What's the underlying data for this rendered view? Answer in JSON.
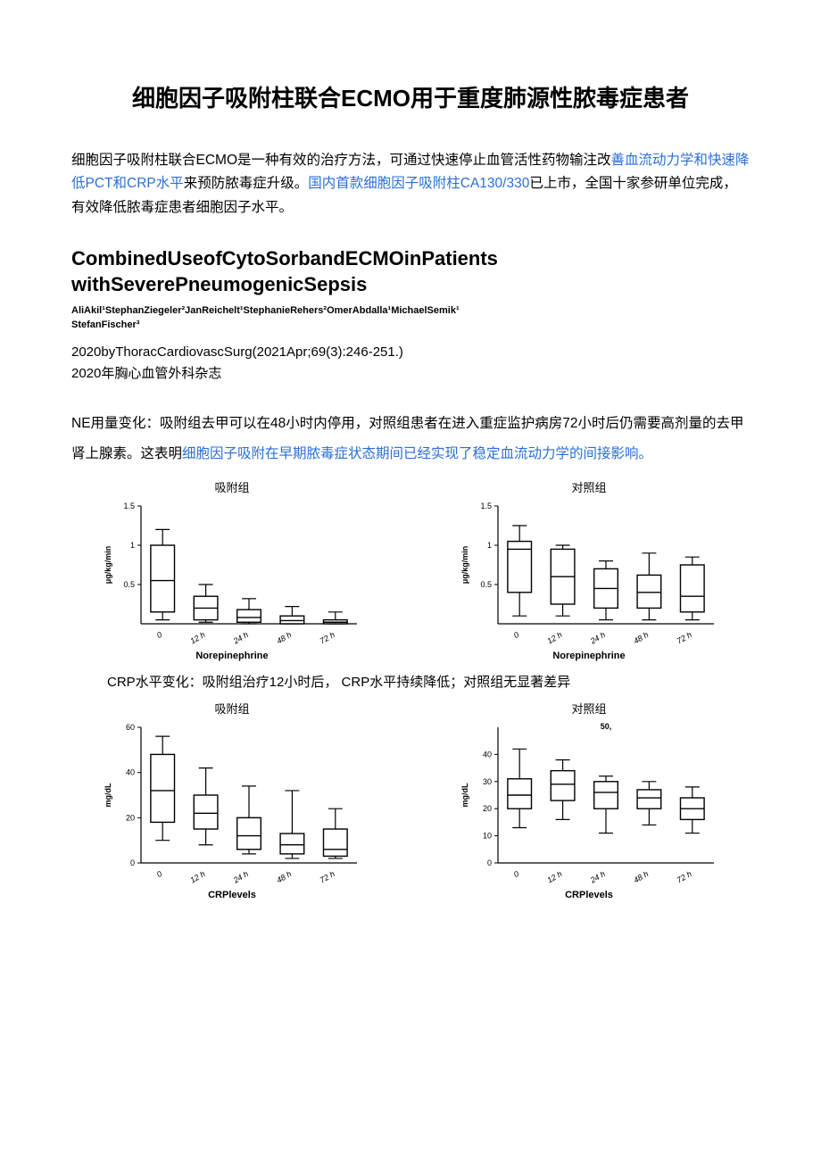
{
  "title": "细胞因子吸附柱联合ECMO用于重度肺源性脓毒症患者",
  "intro_pre": "细胞因子吸附柱联合ECMO是一种有效的治疗方法，可通过快速停止血管活性药物输注改",
  "intro_blue1": "善血流动力学和快速降低PCT和CRP水平",
  "intro_mid": "来预防脓毒症升级。",
  "intro_blue2": "国内首款细胞因子吸附柱CA130/330",
  "intro_post": "已上市，全国十家参研单位完成，有效降低脓毒症患者细胞因子水平。",
  "subtitle_l1": "CombinedUseofCytoSorbandECMOinPatients",
  "subtitle_l2": "withSeverePneumogenicSepsis",
  "authors_l1": "AliAkil¹StephanZiegeler²JanReichelt¹StephanieRehers²OmerAbdalla¹MichaelSemik¹",
  "authors_l2": "StefanFischer³",
  "citation1": "2020byThoracCardiovascSurg(2021Apr;69(3):246-251.)",
  "citation2": "2020年胸心血管外科杂志",
  "ne_text_pre": "NE用量变化：吸附组去甲可以在48小时内停用，对照组患者在进入重症监护病房72小时后仍需要高剂量的去甲肾上腺素。这表明",
  "ne_text_blue": "细胞因子吸附在早期脓毒症状态期间已经实现了稳定血流动力学的间接影响。",
  "crp_caption": "CRP水平变化：吸附组治疗12小时后， CRP水平持续降低；对照组无显著差异",
  "group_adsorb": "吸附组",
  "group_control": "对照组",
  "ne_xlabel": "Norepinephrine",
  "crp_xlabel": "CRPlevels",
  "chart_data": [
    {
      "id": "ne_adsorb",
      "type": "boxplot",
      "title": "吸附组",
      "xlabel": "Norepinephrine",
      "ylabel": "μg/kg/min",
      "categories": [
        "0",
        "12 h",
        "24 h",
        "48 h",
        "72 h"
      ],
      "ylim": [
        0,
        1.5
      ],
      "yticks": [
        0.5,
        1.0,
        1.5
      ],
      "series": [
        {
          "q1": 0.15,
          "median": 0.55,
          "q3": 1.0,
          "low": 0.05,
          "high": 1.2
        },
        {
          "q1": 0.05,
          "median": 0.2,
          "q3": 0.35,
          "low": 0.02,
          "high": 0.5
        },
        {
          "q1": 0.02,
          "median": 0.08,
          "q3": 0.18,
          "low": 0.0,
          "high": 0.32
        },
        {
          "q1": 0.0,
          "median": 0.04,
          "q3": 0.1,
          "low": 0.0,
          "high": 0.22
        },
        {
          "q1": 0.0,
          "median": 0.02,
          "q3": 0.05,
          "low": 0.0,
          "high": 0.15
        }
      ]
    },
    {
      "id": "ne_control",
      "type": "boxplot",
      "title": "对照组",
      "xlabel": "Norepinephrine",
      "ylabel": "μg/kg/min",
      "categories": [
        "0",
        "12 h",
        "24 h",
        "48 h",
        "72 h"
      ],
      "ylim": [
        0,
        1.5
      ],
      "yticks": [
        0.5,
        1.0,
        1.5
      ],
      "series": [
        {
          "q1": 0.4,
          "median": 0.95,
          "q3": 1.05,
          "low": 0.1,
          "high": 1.25
        },
        {
          "q1": 0.25,
          "median": 0.6,
          "q3": 0.95,
          "low": 0.1,
          "high": 1.0
        },
        {
          "q1": 0.2,
          "median": 0.45,
          "q3": 0.7,
          "low": 0.05,
          "high": 0.8
        },
        {
          "q1": 0.2,
          "median": 0.4,
          "q3": 0.62,
          "low": 0.05,
          "high": 0.9
        },
        {
          "q1": 0.15,
          "median": 0.35,
          "q3": 0.75,
          "low": 0.05,
          "high": 0.85
        }
      ]
    },
    {
      "id": "crp_adsorb",
      "type": "boxplot",
      "title": "吸附组",
      "xlabel": "CRPlevels",
      "ylabel": "mg/dL",
      "categories": [
        "0",
        "12 h",
        "24 h",
        "48 h",
        "72 h"
      ],
      "ylim": [
        0,
        60
      ],
      "yticks": [
        0,
        20,
        40,
        60
      ],
      "series": [
        {
          "q1": 18,
          "median": 32,
          "q3": 48,
          "low": 10,
          "high": 56
        },
        {
          "q1": 15,
          "median": 22,
          "q3": 30,
          "low": 8,
          "high": 42
        },
        {
          "q1": 6,
          "median": 12,
          "q3": 20,
          "low": 4,
          "high": 34
        },
        {
          "q1": 4,
          "median": 8,
          "q3": 13,
          "low": 2,
          "high": 32
        },
        {
          "q1": 3,
          "median": 6,
          "q3": 15,
          "low": 2,
          "high": 24
        }
      ]
    },
    {
      "id": "crp_control",
      "type": "boxplot",
      "title": "对照组",
      "xlabel": "CRPlevels",
      "ylabel": "mg/dL",
      "categories": [
        "0",
        "12 h",
        "24 h",
        "48 h",
        "72 h"
      ],
      "ylim": [
        0,
        50
      ],
      "yticks": [
        0,
        10,
        20,
        30,
        40
      ],
      "annotate_top": "50,",
      "series": [
        {
          "q1": 20,
          "median": 25,
          "q3": 31,
          "low": 13,
          "high": 42
        },
        {
          "q1": 23,
          "median": 29,
          "q3": 34,
          "low": 16,
          "high": 38
        },
        {
          "q1": 20,
          "median": 26,
          "q3": 30,
          "low": 11,
          "high": 32
        },
        {
          "q1": 20,
          "median": 24,
          "q3": 27,
          "low": 14,
          "high": 30
        },
        {
          "q1": 16,
          "median": 20,
          "q3": 24,
          "low": 11,
          "high": 28
        }
      ]
    }
  ]
}
